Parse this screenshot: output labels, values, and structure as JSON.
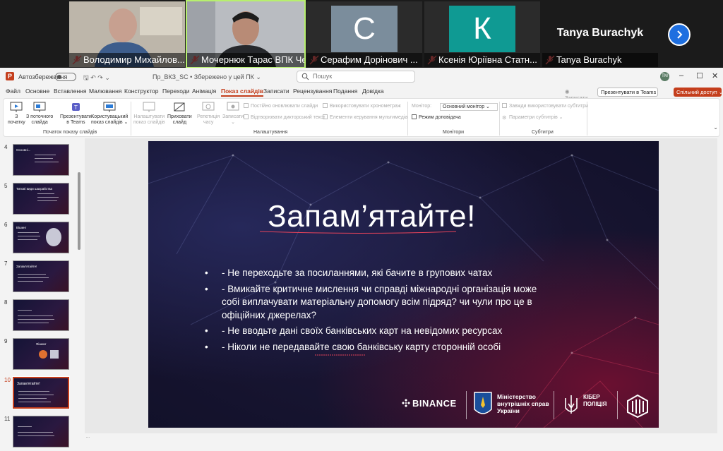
{
  "meeting": {
    "participants": [
      {
        "name": "Володимир Михайлов..."
      },
      {
        "name": "Мочернюк Тарас ВПК Че..."
      },
      {
        "name": "Серафим Дорінович ...",
        "initial": "С",
        "color": "#7b8d9c"
      },
      {
        "name": "Ксенія Юріївна Статн...",
        "initial": "К",
        "color": "#0f9a93"
      },
      {
        "name": "Tanya Burachyk",
        "display": "Tanya Burachyk"
      }
    ],
    "mic_muted_color": "#e05757",
    "next_icon": "chevron-right-icon"
  },
  "ppt": {
    "autosave": "Автозбереження",
    "filename": "Пр_ВКЗ_SC • Збережено у цей ПК ⌄",
    "search_placeholder": "Пошук",
    "user_initials": "TM",
    "win": {
      "min": "–",
      "max": "☐",
      "close": "✕"
    },
    "tabs": [
      "Файл",
      "Основне",
      "Вставлення",
      "Малювання",
      "Конструктор",
      "Переходи",
      "Анімація",
      "Показ слайдів",
      "Записати",
      "Рецензування",
      "Подання",
      "Довідка"
    ],
    "active_tab": "Показ слайдів",
    "record_label": "◉ Записати",
    "present_teams": "Презентувати в Teams",
    "share": "Спільний доступ ⌄",
    "ribbon": {
      "from_start": [
        "З",
        "початку"
      ],
      "from_current": [
        "З поточного",
        "слайда"
      ],
      "present_in_teams": [
        "Презентувати",
        "в Teams"
      ],
      "custom_show": [
        "Користувацький",
        "показ слайдів ⌄"
      ],
      "group_start": "Початок показу слайдів",
      "setup_show": [
        "Налаштувати",
        "показ слайдів"
      ],
      "hide_slide": [
        "Приховати",
        "слайд"
      ],
      "rehearse": [
        "Репетиція",
        "часу"
      ],
      "record": [
        "Записати",
        "⌄"
      ],
      "chk_keep_updated": "Постійно оновлювати слайди",
      "chk_use_timings": "Використовувати хронометраж",
      "chk_play_narrations": "Відтворювати дикторський текст",
      "chk_media_controls": "Елементи керування мультимедіа",
      "group_setup": "Налаштування",
      "monitor_label": "Монітор:",
      "monitor_value": "Основний монітор ⌄",
      "presenter_view": "Режим доповідача",
      "group_monitors": "Монітори",
      "chk_subtitles": "Завжди використовувати субтитри",
      "subtitle_settings": "Параметри субтитрів ⌄",
      "group_subtitles": "Субтитри"
    },
    "thumbs": [
      {
        "num": "4",
        "title": "Основні..."
      },
      {
        "num": "5",
        "title": "Типові види шахрайства"
      },
      {
        "num": "6",
        "title": "Вішинг"
      },
      {
        "num": "7",
        "title": "Запам'ятайте!"
      },
      {
        "num": "8",
        "title": ""
      },
      {
        "num": "9",
        "title": "Фішинг"
      },
      {
        "num": "10",
        "title": "Запам'ятайте!",
        "selected": true
      },
      {
        "num": "11",
        "title": ""
      }
    ],
    "slide": {
      "title": "Запам’ятайте!",
      "bullets": [
        "Не переходьте за посиланнями, які бачите в групових чатах",
        "Вмикайте критичне мислення чи  справді міжнародні організація може собі виплачувати матеріальну допомогу всім підряд? чи чули про це в офіційних джерелах?",
        "Не вводьте дані своїх банківських карт на невідомих ресурсах",
        " Ніколи не передавайте свою банківську карту сторонній особі"
      ],
      "bullet_glyph": "•",
      "bullet_dash": "-",
      "logo_binance": "BINANCE",
      "logo_mvs": [
        "Міністерство",
        "внутрішніх справ",
        "України"
      ],
      "logo_kp": [
        "КІБЕР",
        "ПОЛІЦІЯ"
      ],
      "underline_color": "#e8435a"
    },
    "notes_text": "..."
  }
}
